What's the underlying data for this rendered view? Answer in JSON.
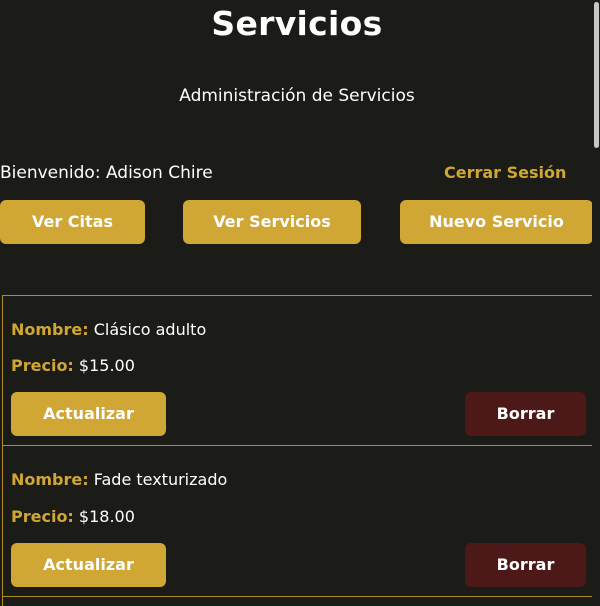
{
  "header": {
    "title": "Servicios",
    "subtitle": "Administración de Servicios"
  },
  "user_bar": {
    "welcome": "Bienvenido: Adison Chire",
    "logout": "Cerrar Sesión"
  },
  "nav": {
    "appointments": "Ver Citas",
    "services": "Ver Servicios",
    "new_service": "Nuevo Servicio"
  },
  "labels": {
    "name": "Nombre:",
    "price": "Precio:"
  },
  "services": [
    {
      "name": "Clásico adulto",
      "price": "$15.00",
      "update_label": "Actualizar",
      "delete_label": "Borrar"
    },
    {
      "name": "Fade texturizado",
      "price": "$18.00",
      "update_label": "Actualizar",
      "delete_label": "Borrar"
    }
  ],
  "colors": {
    "background": "#1b1b17",
    "accent": "#d0a634",
    "danger": "#4c1818",
    "text": "#ffffff"
  }
}
